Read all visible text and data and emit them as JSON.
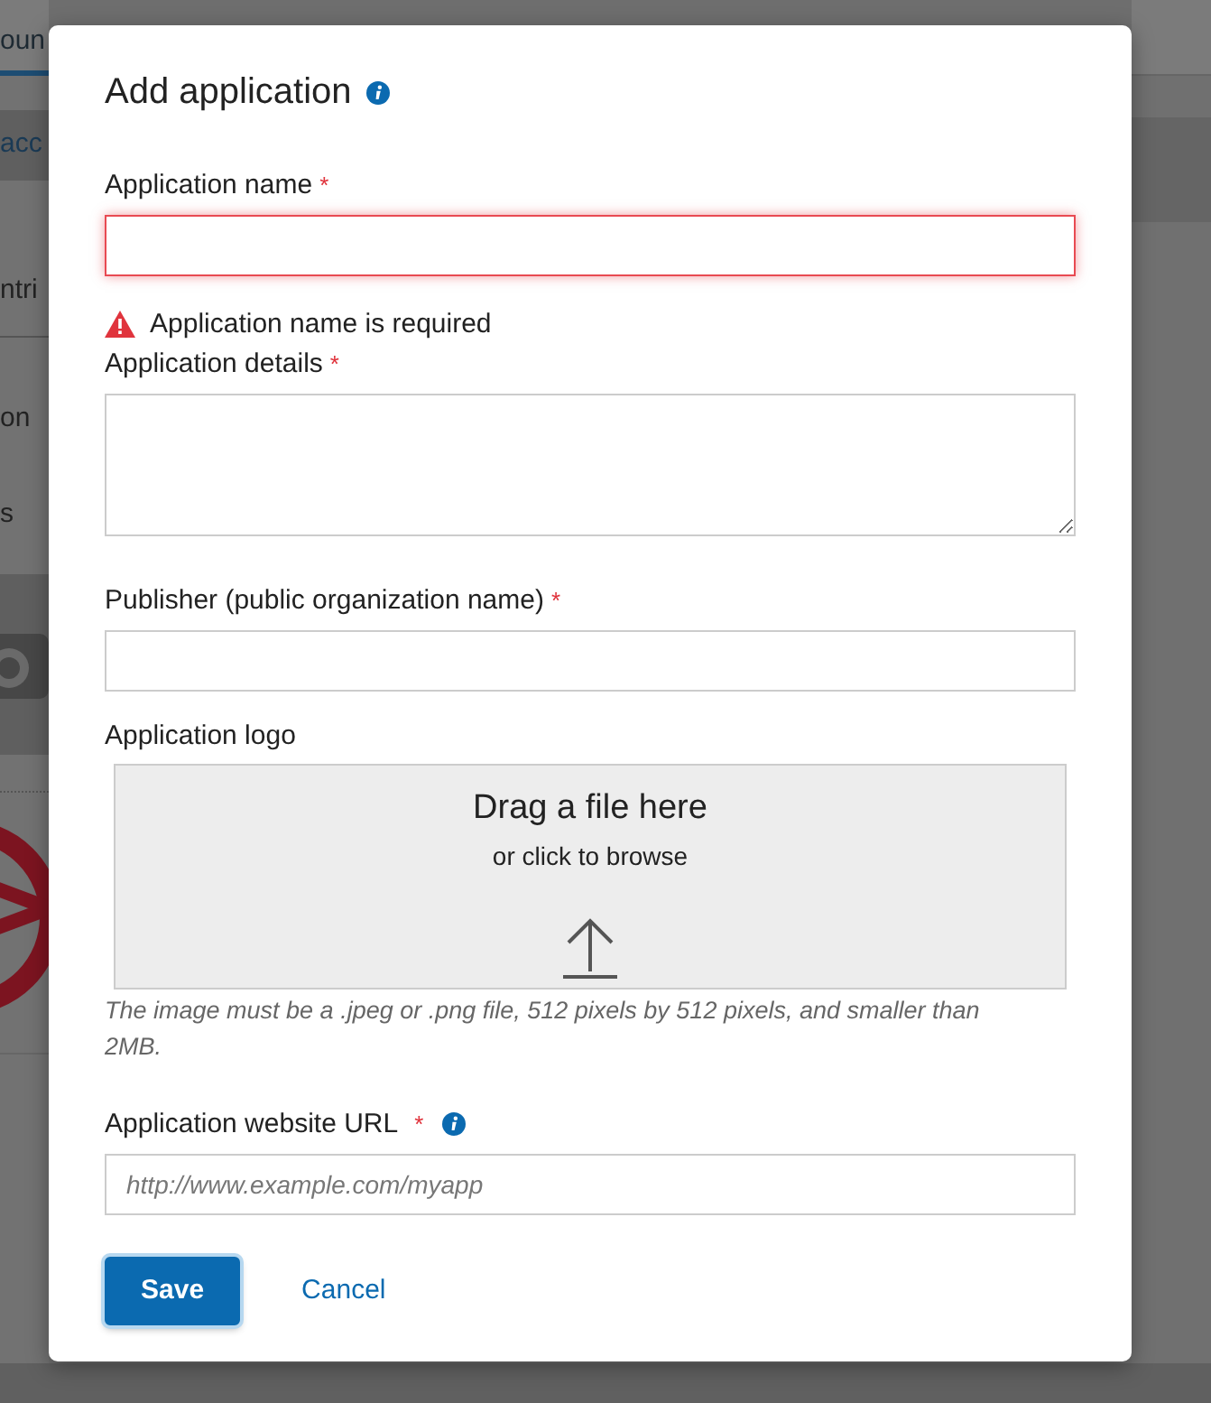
{
  "background": {
    "tab_label": "oun",
    "items": [
      {
        "label": "acc",
        "selected": true
      },
      {
        "label": "ntri",
        "selected": false
      },
      {
        "label": "on",
        "selected": false
      },
      {
        "label": "s",
        "selected": false
      }
    ]
  },
  "dialog": {
    "title": "Add application",
    "title_info": true,
    "fields": [
      {
        "kind": "text",
        "label": "Application name",
        "required": true,
        "invalid": true,
        "error": "Application name is required"
      },
      {
        "kind": "textarea",
        "label": "Application details",
        "required": true,
        "invalid": false
      },
      {
        "kind": "text",
        "label": "Publisher (public organization name)",
        "required": true,
        "invalid": false
      },
      {
        "kind": "file",
        "label": "Application logo",
        "required": false,
        "drop_title": "Drag a file here",
        "drop_subtitle": "or click to browse",
        "help": "The image must be a .jpeg or .png file, 512 pixels by 512 pixels, and smaller than 2MB."
      },
      {
        "kind": "text",
        "label": "Application website URL",
        "required": true,
        "invalid": false,
        "info": true,
        "placeholder": "http://www.example.com/myapp"
      }
    ],
    "required_mark": "*",
    "buttons": [
      {
        "kind": "primary",
        "label": "Save"
      },
      {
        "kind": "link",
        "label": "Cancel"
      }
    ]
  }
}
